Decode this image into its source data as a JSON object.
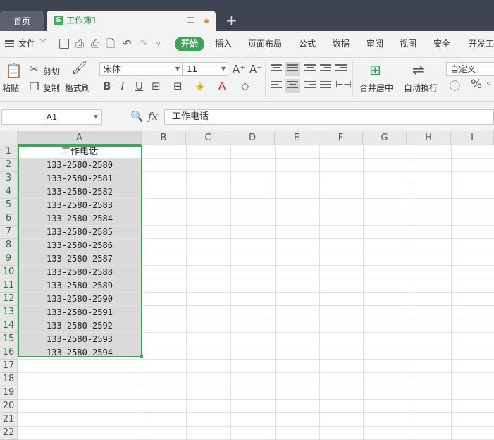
{
  "tabs": {
    "home": "首页",
    "doc": "工作簿1",
    "add": "+"
  },
  "menu": {
    "file": "文件",
    "start": "开始",
    "items": [
      "插入",
      "页面布局",
      "公式",
      "数据",
      "审阅",
      "视图",
      "安全",
      "开发工"
    ]
  },
  "ribbon": {
    "paste": "粘贴",
    "cut": "剪切",
    "copy": "复制",
    "format_painter": "格式刷",
    "font_name": "宋体",
    "font_size": "11",
    "merge_center": "合并居中",
    "wrap_text": "自动换行",
    "number_format": "自定义",
    "percent": "%"
  },
  "formula": {
    "name_box": "A1",
    "fx": "fx",
    "content": "工作电话"
  },
  "columns": [
    "A",
    "B",
    "C",
    "D",
    "E",
    "F",
    "G",
    "H",
    "I"
  ],
  "rows": [
    "1",
    "2",
    "3",
    "4",
    "5",
    "6",
    "7",
    "8",
    "9",
    "10",
    "11",
    "12",
    "13",
    "14",
    "15",
    "16",
    "17",
    "18",
    "19",
    "20",
    "21",
    "22"
  ],
  "cells": {
    "A": [
      "工作电话",
      "133-2580-2580",
      "133-2580-2581",
      "133-2580-2582",
      "133-2580-2583",
      "133-2580-2584",
      "133-2580-2585",
      "133-2580-2586",
      "133-2580-2587",
      "133-2580-2588",
      "133-2580-2589",
      "133-2580-2590",
      "133-2580-2591",
      "133-2580-2592",
      "133-2580-2593",
      "133-2580-2594"
    ]
  },
  "accent": "#3aa457"
}
